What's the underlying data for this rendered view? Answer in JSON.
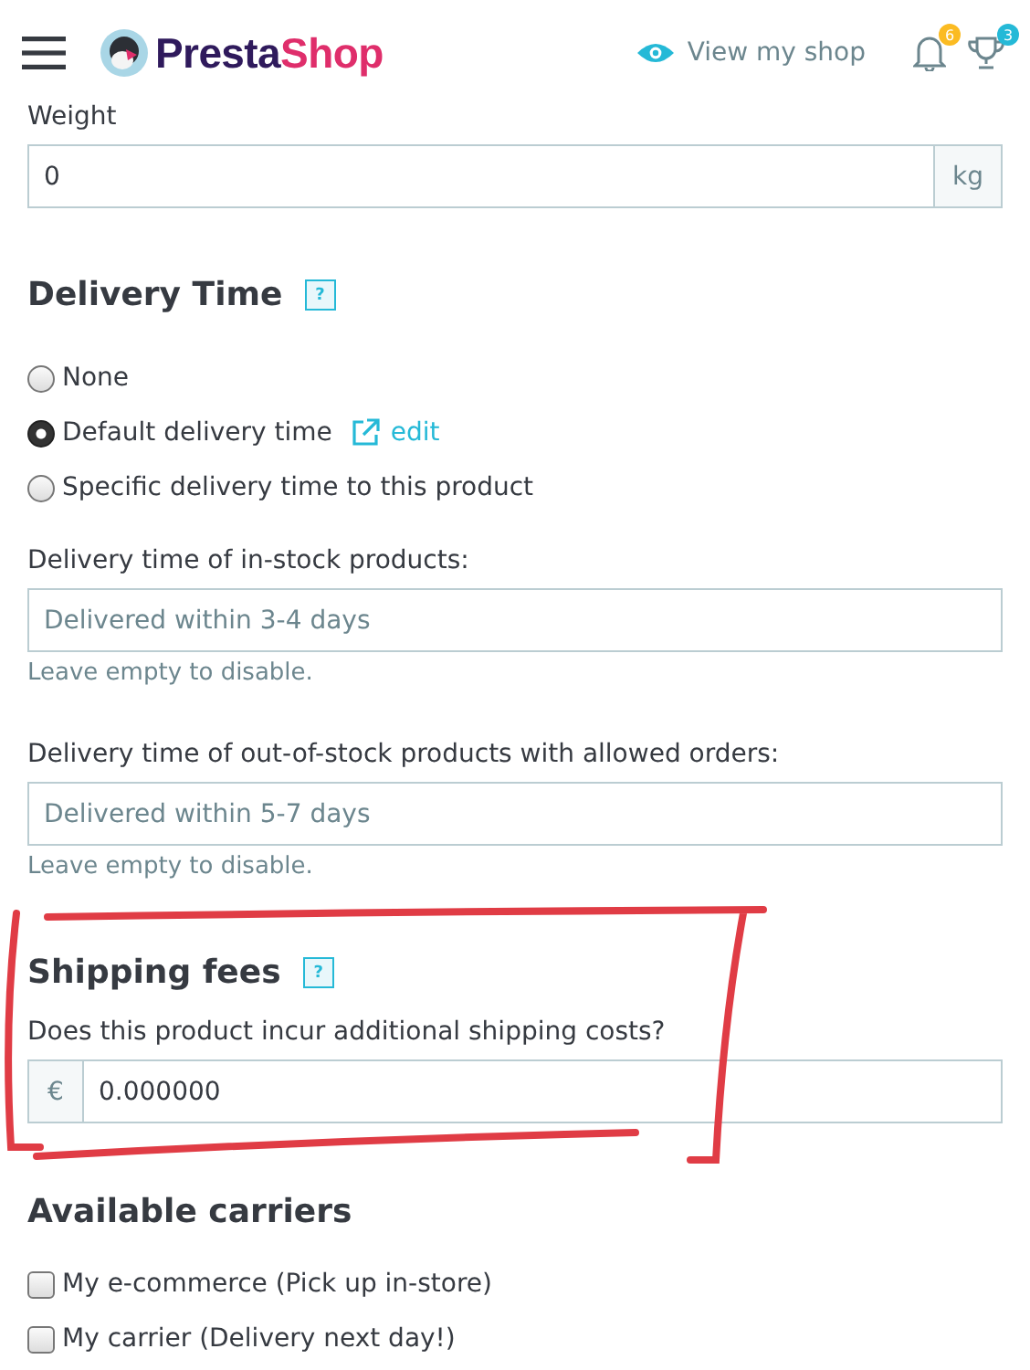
{
  "header": {
    "brand_first": "Presta",
    "brand_second": "Shop",
    "view_shop": "View my shop",
    "notifications_count": "6",
    "trophy_count": "3"
  },
  "weight": {
    "label": "Weight",
    "value": "0",
    "unit": "kg"
  },
  "delivery_time": {
    "title": "Delivery Time",
    "help": "?",
    "options": [
      {
        "label": "None",
        "selected": false
      },
      {
        "label": "Default delivery time",
        "selected": true,
        "link": "edit"
      },
      {
        "label": "Specific delivery time to this product",
        "selected": false
      }
    ],
    "fields": [
      {
        "label": "Delivery time of in-stock products:",
        "placeholder": "Delivered within 3-4 days",
        "hint": "Leave empty to disable."
      },
      {
        "label": "Delivery time of out-of-stock products with allowed orders:",
        "placeholder": "Delivered within 5-7 days",
        "hint": "Leave empty to disable."
      }
    ]
  },
  "shipping_fees": {
    "title": "Shipping fees",
    "help": "?",
    "question": "Does this product incur additional shipping costs?",
    "currency": "€",
    "value": "0.000000"
  },
  "carriers": {
    "title": "Available carriers",
    "items": [
      {
        "label": "My e-commerce (Pick up in-store)",
        "checked": false
      },
      {
        "label": "My carrier (Delivery next day!)",
        "checked": false
      }
    ]
  }
}
